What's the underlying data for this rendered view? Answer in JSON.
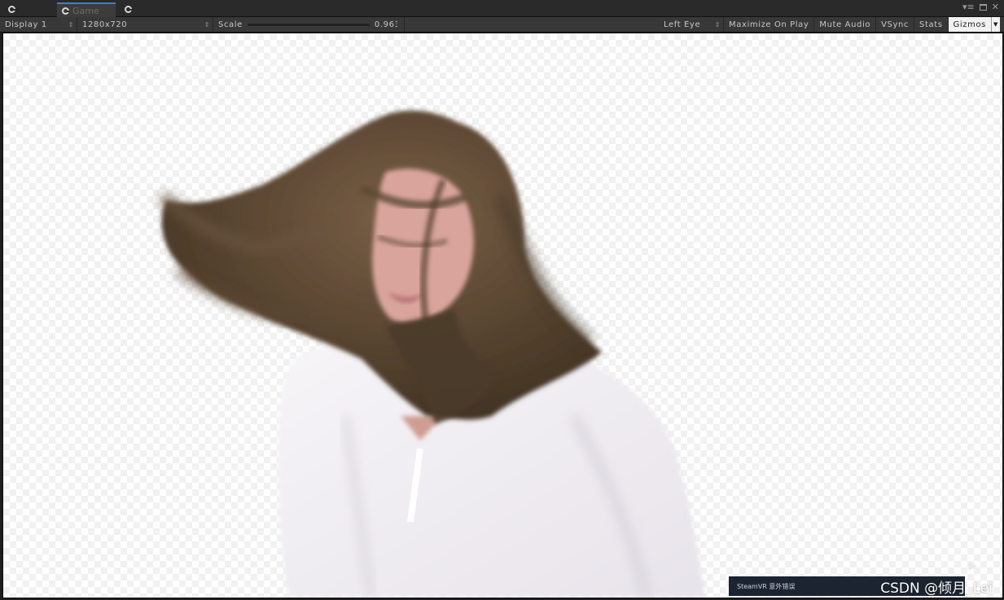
{
  "window": {
    "tabs": [
      {
        "label": "",
        "icon": "unity-icon"
      },
      {
        "label": "Game",
        "icon": "unity-icon",
        "active": true
      },
      {
        "label": "",
        "icon": "unity-icon"
      }
    ],
    "controls": [
      "menu-icon",
      "maximize-icon",
      "close-icon"
    ]
  },
  "toolbar": {
    "display": "Display 1",
    "resolution": "1280x720",
    "scale_label": "Scale",
    "scale_value": "0.963",
    "eye": "Left Eye",
    "maximize_on_play": "Maximize On Play",
    "mute_audio": "Mute Audio",
    "vsync": "VSync",
    "stats": "Stats",
    "gizmos": "Gizmos",
    "gizmos_active": true
  },
  "viewport": {
    "background": "transparent-checkerboard",
    "content": "chroma-keyed video frame of a woman with flowing brown hair in a white blouse",
    "hair_color": "#5a4630",
    "blouse_color": "#f2eff3",
    "skin_color": "#d8a39c"
  },
  "steamvr_banner": "SteamVR 意外错误",
  "watermark": "CSDN @倾月_Lei"
}
